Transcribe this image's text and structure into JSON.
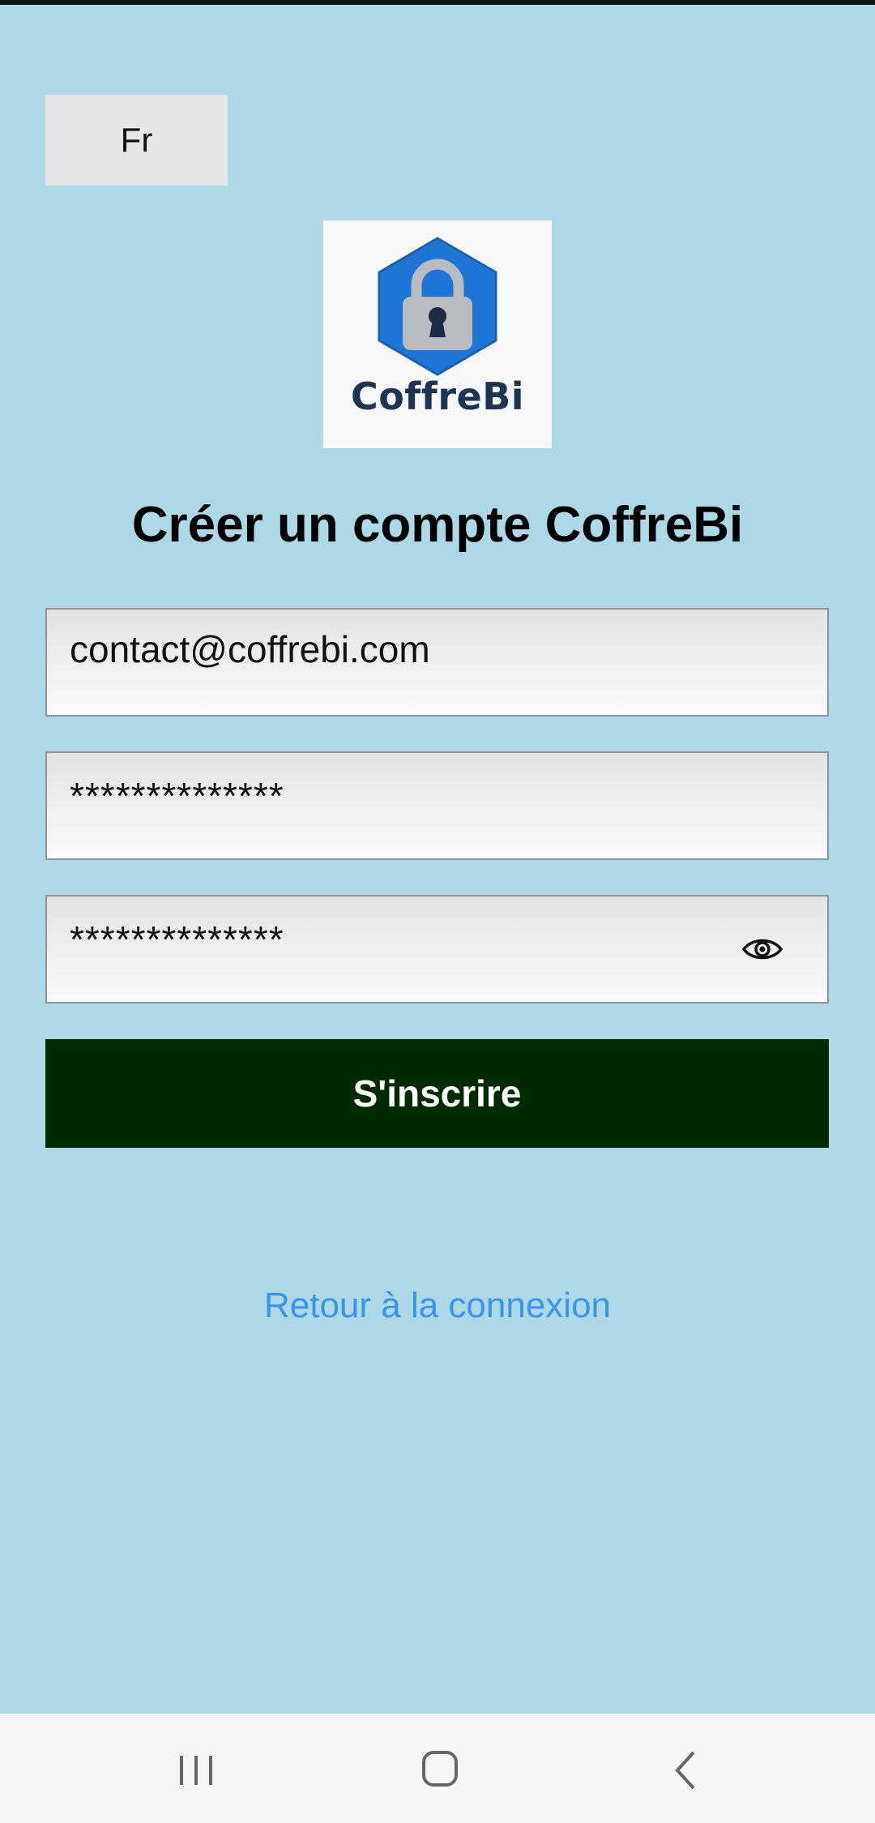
{
  "language": {
    "current": "Fr"
  },
  "logo": {
    "text": "CoffreBi",
    "icon": "padlock-hexagon-icon",
    "hex_color": "#1f75d6"
  },
  "title": "Créer un compte CoffreBi",
  "form": {
    "email_value": "contact@coffrebi.com",
    "password_mask": "**************",
    "confirm_password_mask": "**************",
    "show_password_icon": "eye-icon",
    "submit_label": "S'inscrire"
  },
  "back_link": "Retour à la connexion",
  "colors": {
    "background": "#add8e6",
    "submit_bg": "#002a00",
    "link": "#3b94ec"
  },
  "nav": {
    "recent_icon": "recent-apps-icon",
    "home_icon": "home-icon",
    "back_icon": "back-icon"
  }
}
